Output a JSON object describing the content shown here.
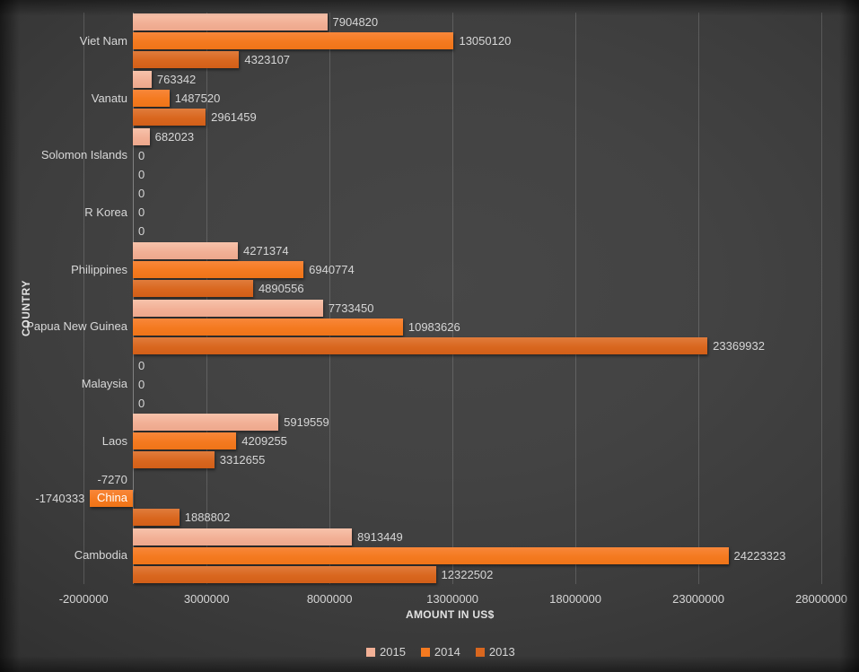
{
  "chart_data": {
    "type": "bar",
    "orientation": "horizontal",
    "title": "",
    "xlabel": "AMOUNT IN US$",
    "ylabel": "COUNTRY",
    "xlim": [
      -2000000,
      28000000
    ],
    "xticks": [
      "-2000000",
      "3000000",
      "8000000",
      "13000000",
      "18000000",
      "23000000",
      "28000000"
    ],
    "xtick_values": [
      -2000000,
      3000000,
      8000000,
      13000000,
      18000000,
      23000000,
      28000000
    ],
    "grid": true,
    "legend_position": "bottom",
    "series": [
      {
        "name": "2015",
        "color": "#f2b096",
        "values": [
          7904820,
          763342,
          682023,
          0,
          4271374,
          7733450,
          0,
          5919559,
          -7270,
          8913449
        ]
      },
      {
        "name": "2014",
        "color": "#f47a20",
        "values": [
          13050120,
          1487520,
          0,
          0,
          6940774,
          10983626,
          0,
          4209255,
          -1740333,
          24223323
        ]
      },
      {
        "name": "2013",
        "color": "#d9671f",
        "values": [
          4323107,
          2961459,
          0,
          0,
          4890556,
          23369932,
          0,
          3312655,
          1888802,
          12322502
        ]
      }
    ],
    "categories": [
      "Viet Nam",
      "Vanatu",
      "Solomon Islands",
      "R Korea",
      "Philippines",
      "Papua New Guinea",
      "Malaysia",
      "Laos",
      "China",
      "Cambodia"
    ],
    "data_labels": [
      [
        "7904820",
        "13050120",
        "4323107"
      ],
      [
        "763342",
        "1487520",
        "2961459"
      ],
      [
        "682023",
        "0",
        "0"
      ],
      [
        "0",
        "0",
        "0"
      ],
      [
        "4271374",
        "6940774",
        "4890556"
      ],
      [
        "7733450",
        "10983626",
        "23369932"
      ],
      [
        "0",
        "0",
        "0"
      ],
      [
        "5919559",
        "4209255",
        "3312655"
      ],
      [
        "-7270",
        "-1740333",
        "1888802"
      ],
      [
        "8913449",
        "24223323",
        "12322502"
      ]
    ]
  },
  "legend": {
    "items": [
      {
        "label": "2015",
        "color": "#f2b096"
      },
      {
        "label": "2014",
        "color": "#f47a20"
      },
      {
        "label": "2013",
        "color": "#d9671f"
      }
    ]
  },
  "theme": {
    "background": "#3c3c3c",
    "text": "#d6d6d6",
    "gridline": "rgba(255,255,255,0.16)"
  }
}
